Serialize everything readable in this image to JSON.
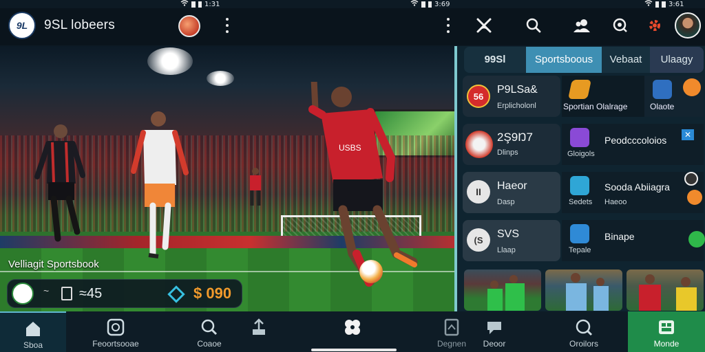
{
  "status_bars": [
    {
      "time": "1:31"
    },
    {
      "time": "3:69"
    },
    {
      "time": "3:61"
    }
  ],
  "header": {
    "logo_text": "9L",
    "app_name": "9SL lobeers"
  },
  "hero": {
    "caption": "Velliagit Sportsbook",
    "bet_bar": {
      "tilde": "~",
      "value": "≈45",
      "amount": "$ 090"
    },
    "jersey_text": "USBS"
  },
  "panel": {
    "tabs": [
      {
        "label": "99Sl"
      },
      {
        "label": "Sportsboous"
      },
      {
        "label": "Vebaat"
      },
      {
        "label": "Ulaagy"
      }
    ],
    "rows": [
      {
        "title": "P9LSa&",
        "subtitle": "Erplicholonl",
        "badge": "56",
        "mid_label": "Sportian Olalrage",
        "right_label": "Olaote"
      },
      {
        "title": "2Ş9Ŋ7",
        "subtitle": "Dlinps",
        "mid_title": "Peodcccoloios",
        "mid_sub": "Gloigols"
      },
      {
        "title": "Haeor",
        "subtitle": "Dasp",
        "badge": "II",
        "mid_title": "Sooda Abiiagra",
        "mid_sub": "Sedets",
        "mid_sub2": "Haeoo"
      },
      {
        "title": "SVS",
        "subtitle": "Llaap",
        "badge": "(S",
        "mid_title": "Binape",
        "mid_sub": "Tepale"
      }
    ]
  },
  "bottom_nav": [
    {
      "label": "Sboa"
    },
    {
      "label": "Feoortsooae"
    },
    {
      "label": "Coaoe"
    },
    {
      "label": ""
    },
    {
      "label": ""
    },
    {
      "label": "Degnen"
    },
    {
      "label": "Deoor"
    },
    {
      "label": "Oroilors"
    },
    {
      "label": "Monde"
    }
  ],
  "colors": {
    "accent_tab": "#3e8fb3",
    "active_nav_right": "#1f8c4a",
    "amount": "#f19a2c"
  }
}
